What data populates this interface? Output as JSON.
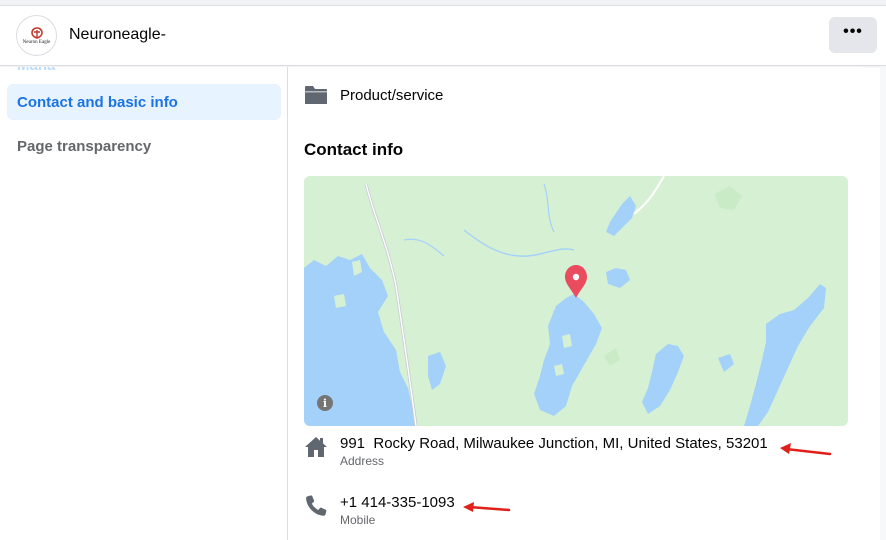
{
  "header": {
    "page_name": "Neuroneagle-",
    "logo_text": "Neuron Eagle",
    "more_label": "•••"
  },
  "sidebar": {
    "items": [
      {
        "label": "Contact and basic info",
        "active": true
      },
      {
        "label": "Page transparency",
        "active": false
      }
    ]
  },
  "main": {
    "category": {
      "label": "Product/service",
      "icon": "folder-icon"
    },
    "contact_section_title": "Contact info",
    "map": {
      "info_label": "i",
      "icon": "map-pin-icon"
    },
    "contact": {
      "address": {
        "value": "991  Rocky Road, Milwaukee Junction, MI, United States, 53201",
        "label": "Address",
        "icon": "home-icon"
      },
      "phone": {
        "value": "+1 414-335-1093",
        "label": "Mobile",
        "icon": "phone-icon"
      }
    }
  },
  "colors": {
    "accent": "#1b74e4",
    "active_bg": "#e7f3ff",
    "annotation_arrow": "#e0201a",
    "map_land": "#d6f0d3",
    "map_water": "#a4d1f9",
    "map_pin": "#ea4c5f"
  }
}
